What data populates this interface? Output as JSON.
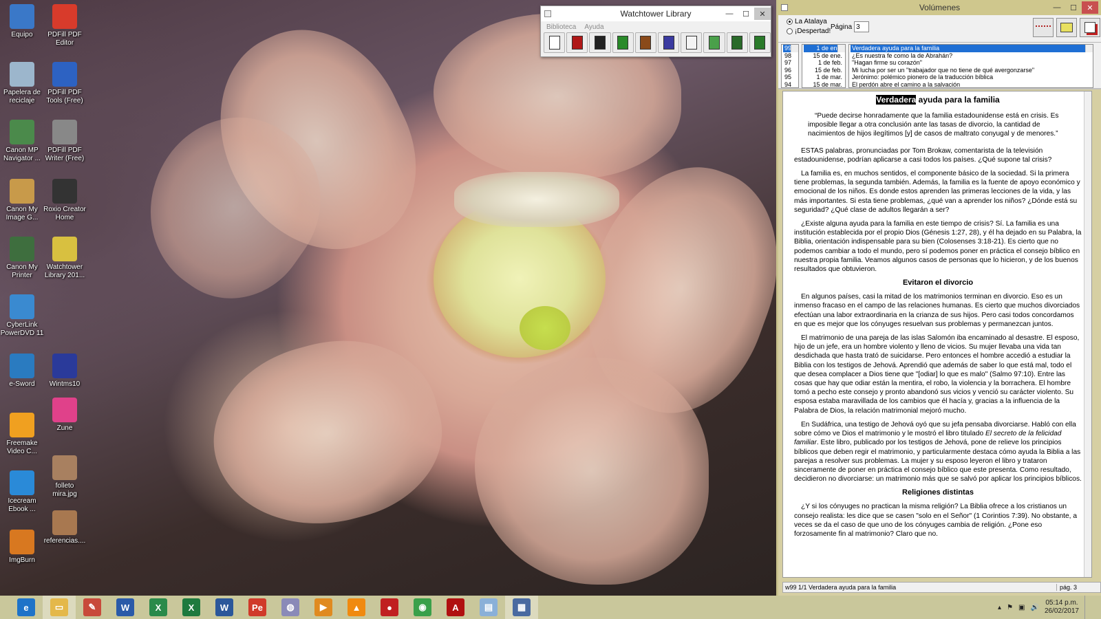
{
  "desktop": {
    "icons": [
      {
        "label": "Equipo",
        "color": "#3a78c8"
      },
      {
        "label": "PDFill PDF Editor",
        "color": "#d83b2b"
      },
      {
        "label": "Papelera de reciclaje",
        "color": "#9cb6cc"
      },
      {
        "label": "PDFill PDF Tools (Free)",
        "color": "#2d62c2"
      },
      {
        "label": "Canon MP Navigator ...",
        "color": "#4b8a4b"
      },
      {
        "label": "PDFill PDF Writer (Free)",
        "color": "#888888"
      },
      {
        "label": "Canon My Image G...",
        "color": "#c89a4a"
      },
      {
        "label": "Roxio Creator Home",
        "color": "#333333"
      },
      {
        "label": "Canon My Printer",
        "color": "#3e6e3e"
      },
      {
        "label": "Watchtower Library 201...",
        "color": "#d8c040"
      },
      {
        "label": "CyberLink PowerDVD 11",
        "color": "#3a8ad0"
      },
      {
        "label": "e-Sword",
        "color": "#2a7bc0"
      },
      {
        "label": "Wintms10",
        "color": "#2a3a9a"
      },
      {
        "label": "Zune",
        "color": "#e0418a"
      },
      {
        "label": "Freemake Video C...",
        "color": "#f0a020"
      },
      {
        "label": "folleto mira.jpg",
        "color": "#a88060"
      },
      {
        "label": "Icecream Ebook ...",
        "color": "#2a8ad8"
      },
      {
        "label": "referencias....",
        "color": "#a87850"
      },
      {
        "label": "ImgBurn",
        "color": "#d87820"
      }
    ]
  },
  "wtl": {
    "title": "Watchtower Library",
    "menu": [
      "Biblioteca",
      "Ayuda"
    ],
    "tools": [
      {
        "name": "library-icon",
        "color": "#ffffff"
      },
      {
        "name": "bible-icon",
        "color": "#b01818"
      },
      {
        "name": "book-dark-icon",
        "color": "#222222"
      },
      {
        "name": "book-green-icon",
        "color": "#2a8a2a"
      },
      {
        "name": "books-icon",
        "color": "#8a4a1a"
      },
      {
        "name": "books-colored-icon",
        "color": "#3a3aa0"
      },
      {
        "name": "index-icon",
        "color": "#f4f4f4"
      },
      {
        "name": "copy-icon",
        "color": "#4aa04a"
      },
      {
        "name": "search-icon",
        "color": "#2a6a2a"
      },
      {
        "name": "edit-icon",
        "color": "#2a7a2a"
      }
    ]
  },
  "vol": {
    "title": "Volúmenes",
    "radio1": "La Atalaya",
    "radio2": "¡Despertad!",
    "page_label": "Página",
    "page_value": "3",
    "years": [
      "99",
      "98",
      "97",
      "96",
      "95",
      "94"
    ],
    "dates": [
      "1 de ene.",
      "15 de ene.",
      "1 de feb.",
      "15 de feb.",
      "1 de mar.",
      "15 de mar."
    ],
    "titles": [
      "Verdadera ayuda para la familia",
      "¿Es nuestra fe como la de Abrahán?",
      "\"Hagan firme su corazón\"",
      "Mi lucha por ser un \"trabajador que no tiene de qué avergonzarse\"",
      "Jerónimo: polémico pionero de la traducción bíblica",
      "El perdón abre el camino a la salvación"
    ],
    "status_left": "w99 1/1 Verdadera ayuda para la familia",
    "status_right": "pág. 3"
  },
  "article": {
    "title_hl": "Verdadera",
    "title_rest": " ayuda para la familia",
    "quote": "“Puede decirse honradamente que la familia estadounidense está en crisis. Es imposible llegar a otra conclusión ante las tasas de divorcio, la cantidad de nacimientos de hijos ilegítimos [y] de casos de maltrato conyugal y de menores.”",
    "p1": "ESTAS palabras, pronunciadas por Tom Brokaw, comentarista de la televisión estadounidense, podrían aplicarse a casi todos los países. ¿Qué supone tal crisis?",
    "p2": "La familia es, en muchos sentidos, el componente básico de la sociedad. Si la primera tiene problemas, la segunda también. Además, la familia es la fuente de apoyo económico y emocional de los niños. Es donde estos aprenden las primeras lecciones de la vida, y las más importantes. Si esta tiene problemas, ¿qué van a aprender los niños? ¿Dónde está su seguridad? ¿Qué clase de adultos llegarán a ser?",
    "p3": "¿Existe alguna ayuda para la familia en este tiempo de crisis? Sí. La familia es una institución establecida por el propio Dios (Génesis 1:27, 28), y él ha dejado en su Palabra, la Biblia, orientación indispensable para su bien (Colosenses 3:18-21). Es cierto que no podemos cambiar a todo el mundo, pero sí podemos poner en práctica el consejo bíblico en nuestra propia familia. Veamos algunos casos de personas que lo hicieron, y de los buenos resultados que obtuvieron.",
    "h1": "Evitaron el divorcio",
    "p4": "En algunos países, casi la mitad de los matrimonios terminan en divorcio. Eso es un inmenso fracaso en el campo de las relaciones humanas. Es cierto que muchos divorciados efectúan una labor extraordinaria en la crianza de sus hijos. Pero casi todos concordamos en que es mejor que los cónyuges resuelvan sus problemas y permanezcan juntos.",
    "p5": "El matrimonio de una pareja de las islas Salomón iba encaminado al desastre. El esposo, hijo de un jefe, era un hombre violento y lleno de vicios. Su mujer llevaba una vida tan desdichada que hasta trató de suicidarse. Pero entonces el hombre accedió a estudiar la Biblia con los testigos de Jehová. Aprendió que además de saber lo que está mal, todo el que desea complacer a Dios tiene que \"[odiar] lo que es malo\" (Salmo 97:10). Entre las cosas que hay que odiar están la mentira, el robo, la violencia y la borrachera. El hombre tomó a pecho este consejo y pronto abandonó sus vicios y venció su carácter violento. Su esposa estaba maravillada de los cambios que él hacía y, gracias a la influencia de la Palabra de Dios, la relación matrimonial mejoró mucho.",
    "p6a": "En Sudáfrica, una testigo de Jehová oyó que su jefa pensaba divorciarse. Habló con ella sobre cómo ve Dios el matrimonio y le mostró el libro titulado ",
    "p6em": "El secreto de la felicidad familiar",
    "p6b": ". Este libro, publicado por los testigos de Jehová, pone de relieve los principios bíblicos que deben regir el matrimonio, y particularmente destaca cómo ayuda la Biblia a las parejas a resolver sus problemas. La mujer y su esposo leyeron el libro y trataron sinceramente de poner en práctica el consejo bíblico que este presenta. Como resultado, decidieron no divorciarse: un matrimonio más que se salvó por aplicar los principios bíblicos.",
    "h2": "Religiones distintas",
    "p7": "¿Y si los cónyuges no practican la misma religión? La Biblia ofrece a los cristianos un consejo realista: les dice que se casen \"solo en el Señor\" (1 Corintios 7:39). No obstante, a veces se da el caso de que uno de los cónyuges cambia de religión. ¿Pone eso forzosamente fin al matrimonio? Claro que no."
  },
  "taskbar": {
    "apps": [
      {
        "name": "internet-explorer-icon",
        "glyph": "e",
        "color": "#1e73c8"
      },
      {
        "name": "file-explorer-icon",
        "glyph": "▭",
        "color": "#e4b84a"
      },
      {
        "name": "paint-icon",
        "glyph": "✎",
        "color": "#c84a3a"
      },
      {
        "name": "wordpad-icon",
        "glyph": "W",
        "color": "#2a5aa8"
      },
      {
        "name": "excel-viewer-icon",
        "glyph": "X",
        "color": "#2a8a4a"
      },
      {
        "name": "excel-icon",
        "glyph": "X",
        "color": "#1e7a3e"
      },
      {
        "name": "word-icon",
        "glyph": "W",
        "color": "#2b579a"
      },
      {
        "name": "pe-icon",
        "glyph": "Pe",
        "color": "#d03a2a"
      },
      {
        "name": "colorful-app-icon",
        "glyph": "◍",
        "color": "#8a8ab8"
      },
      {
        "name": "media-player-icon",
        "glyph": "▶",
        "color": "#e08a20"
      },
      {
        "name": "vlc-icon",
        "glyph": "▲",
        "color": "#f08a10"
      },
      {
        "name": "cd-burner-icon",
        "glyph": "●",
        "color": "#c02020"
      },
      {
        "name": "chrome-icon",
        "glyph": "◉",
        "color": "#3aa04a"
      },
      {
        "name": "acrobat-icon",
        "glyph": "A",
        "color": "#b01010"
      },
      {
        "name": "document-app-icon",
        "glyph": "▤",
        "color": "#8ab0d8"
      },
      {
        "name": "watchtower-library-icon",
        "glyph": "▦",
        "color": "#4a6aa0"
      }
    ],
    "time": "05:14 p.m.",
    "date": "26/02/2017"
  }
}
